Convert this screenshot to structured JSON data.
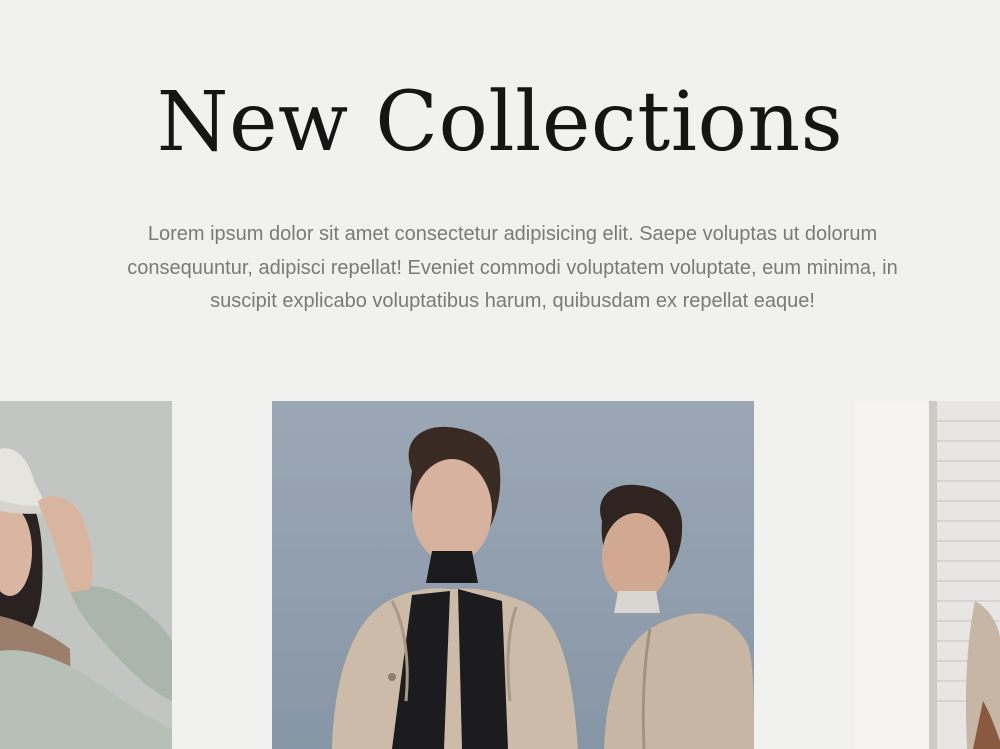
{
  "section": {
    "title": "New Collections",
    "description": "Lorem ipsum dolor sit amet consectetur adipisicing elit. Saepe voluptas ut dolorum consequuntur, adipisci repellat! Eveniet commodi voluptatem voluptate, eum minima, in suscipit explicabo voluptatibus harum, quibusdam ex repellat eaque!"
  },
  "colors": {
    "background": "#f1f1f0",
    "heading": "#151515",
    "body_text": "#7a7a7a",
    "sky": "#8f9cab",
    "coat": "#c8b9a6"
  },
  "gallery": {
    "items": [
      {
        "name": "collection-photo-left",
        "subject": "model-in-bucket-hat"
      },
      {
        "name": "collection-photo-center",
        "subject": "two-models-in-trench-coats"
      },
      {
        "name": "collection-photo-right",
        "subject": "model-by-window"
      }
    ]
  }
}
